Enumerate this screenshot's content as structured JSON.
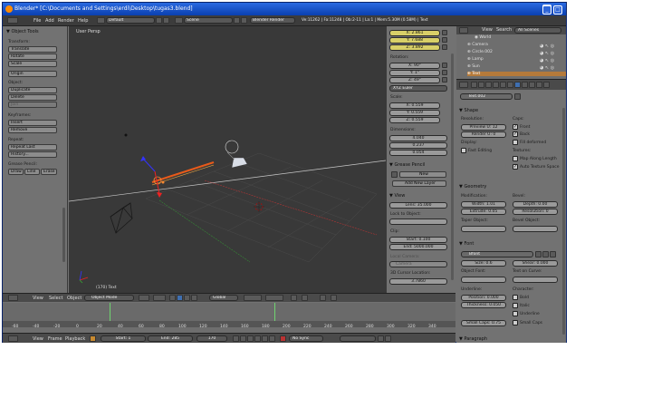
{
  "window": {
    "title": "Blender* [C:\\Documents and Settings\\erdi\\Desktop\\tugas3.blend]",
    "min_glyph": "_",
    "max_glyph": "□",
    "close_glyph": "×"
  },
  "infobar": {
    "menus": [
      "File",
      "Add",
      "Render",
      "Help"
    ],
    "screen": "Default",
    "scene": "Scene",
    "engine": "Blender Render",
    "stats": "Ve:11262 | Fa:11248 | Ob:2-11 | La:1 | Mem:5.30M (0.58M) | Text"
  },
  "tool_shelf": {
    "title": "Object Tools",
    "sections": [
      {
        "heading": "Transform:",
        "buttons": [
          "Translate",
          "Rotate",
          "Scale"
        ]
      },
      {
        "heading": "",
        "buttons": [
          "Origin"
        ]
      },
      {
        "heading": "Object:",
        "buttons": [
          "Duplicate",
          "Delete",
          "Join"
        ]
      },
      {
        "heading": "Keyframes:",
        "buttons": [
          "Insert",
          "Remove"
        ]
      },
      {
        "heading": "Repeat:",
        "buttons": [
          "Repeat Last",
          "History..."
        ]
      }
    ],
    "grease_pencil": {
      "heading": "Grease Pencil:",
      "buttons": [
        "Draw",
        "Line",
        "Erase"
      ]
    }
  },
  "viewport": {
    "label": "User Persp",
    "footer_label": "(170) Text"
  },
  "viewport_header": {
    "menus": [
      "View",
      "Select",
      "Object"
    ],
    "mode": "Object Mode",
    "orientation": "Global"
  },
  "properties_n": {
    "location": {
      "x": "X: 2.861",
      "y": "Y: 7.688",
      "z": "Z: 3.892"
    },
    "rotation_label": "Rotation:",
    "rotation": {
      "x": "X: 90°",
      "y": "Y: 1°",
      "z": "Z: 49°"
    },
    "rotation_mode": "XYZ Euler",
    "scale_label": "Scale:",
    "scale": {
      "x": "X: 0.559",
      "y": "Y: 0.559",
      "z": "Z: 0.559"
    },
    "dimensions_label": "Dimensions:",
    "dimensions": [
      "4.040",
      "0.237",
      "0.054"
    ],
    "grease_pencil": {
      "title": "Grease Pencil",
      "new_label": "New",
      "new_layer_label": "Add New Layer"
    },
    "view": {
      "title": "View",
      "lens": "Lens: 35.000",
      "lock_label": "Lock to Object:",
      "clip_label": "Clip:",
      "clip_start": "Start: 0.100",
      "clip_end": "End: 5000.000",
      "local_camera_label": "Local Camera:",
      "camera_field": "Camera",
      "cursor_label": "3D Cursor Location:",
      "cursor_x": "3.7860"
    }
  },
  "timeline": {
    "ticks": [
      "-60",
      "-40",
      "-20",
      "0",
      "20",
      "40",
      "60",
      "80",
      "100",
      "120",
      "140",
      "160",
      "180",
      "200",
      "220",
      "240",
      "260",
      "280",
      "300",
      "320",
      "340"
    ],
    "menus": [
      "View",
      "Frame",
      "Playback"
    ],
    "start": "Start: 1",
    "end": "End: 285",
    "current": "170",
    "sync": "No Sync"
  },
  "outliner": {
    "view_label": "View",
    "search_label": "Search",
    "display": "All Scenes",
    "items": [
      "World",
      "Camera",
      "Circle.002",
      "Lamp",
      "Sun",
      "Text"
    ]
  },
  "properties": {
    "datablock_name": "Text.002",
    "shape": {
      "title": "Shape",
      "resolution_label": "Resolution:",
      "preview": "Preview U: 12",
      "render": "Render U: 0",
      "display_label": "Display:",
      "fast_editing": "Fast Editing",
      "caps_label": "Caps:",
      "front": "Front",
      "back": "Back",
      "fill_deformed": "Fill deformed",
      "textures_label": "Textures:",
      "map_along_length": "Map Along Length",
      "auto_texture_space": "Auto Texture Space"
    },
    "geometry": {
      "title": "Geometry",
      "modification_label": "Modification:",
      "width": "Width: 1.01",
      "extrude": "Extrude: 0.05",
      "taper_label": "Taper Object:",
      "bevel_label": "Bevel:",
      "depth": "Depth: 0.00",
      "resolution": "Resolution: 0",
      "bevel_object_label": "Bevel Object:"
    },
    "font": {
      "title": "Font",
      "font_name": "Bfont",
      "size": "Size: 0.6",
      "shear": "Shear: 0.000",
      "object_font_label": "Object Font:",
      "text_on_curve_label": "Text on Curve:",
      "underline_label": "Underline:",
      "position": "Position: 0.000",
      "thickness": "Thickness: 0.050",
      "character_label": "Character:",
      "bold": "Bold",
      "italic": "Italic",
      "underline": "Underline",
      "small_caps_field": "Small Caps: 0.75",
      "small_caps": "Small Caps"
    },
    "paragraph_title": "Paragraph"
  }
}
